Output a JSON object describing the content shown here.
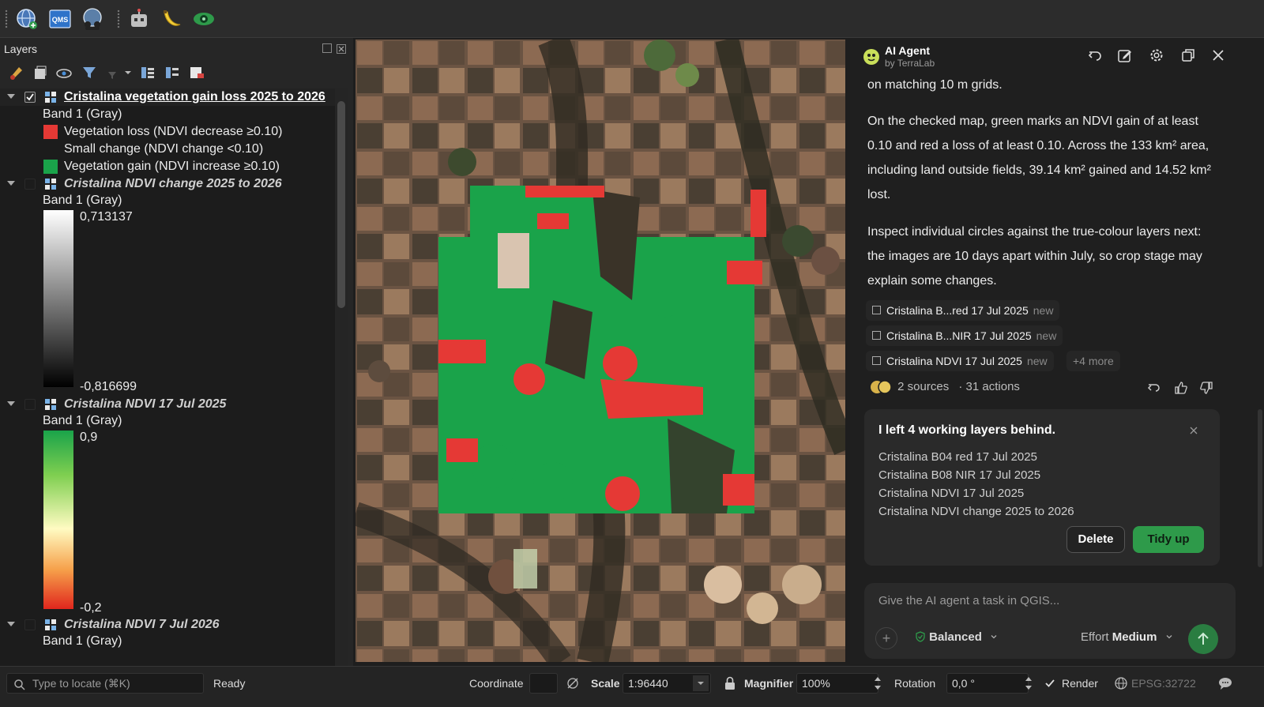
{
  "toolbar": {
    "icons": [
      "globe-add-icon",
      "qms-icon",
      "globe-people-icon",
      "robot-icon",
      "banana-icon",
      "eye-icon"
    ],
    "qms_label": "QMS"
  },
  "layers_panel": {
    "title": "Layers",
    "tree": [
      {
        "name": "Cristalina vegetation gain loss 2025 to 2026",
        "checked": true,
        "active": true
      },
      {
        "band": "Band 1 (Gray)"
      },
      {
        "legend": [
          {
            "label": "Vegetation loss (NDVI decrease ≥0.10)",
            "color": "#e53935"
          },
          {
            "label": "Small change (NDVI change <0.10)",
            "color": "transparent"
          },
          {
            "label": "Vegetation gain (NDVI increase ≥0.10)",
            "color": "#1aa34a"
          }
        ]
      },
      {
        "name": "Cristalina NDVI change 2025 to 2026",
        "checked": false,
        "band": "Band 1 (Gray)",
        "max": "0,713137",
        "min": "-0,816699"
      },
      {
        "name": "Cristalina NDVI 17 Jul 2025",
        "checked": false,
        "band": "Band 1 (Gray)",
        "max": "0,9",
        "min": "-0,2"
      },
      {
        "name": "Cristalina NDVI 7 Jul 2026",
        "checked": false,
        "band": "Band 1 (Gray)"
      }
    ]
  },
  "ai_panel": {
    "title": "AI Agent",
    "subtitle": "by TerraLab",
    "messages": [
      "on matching 10 m grids.",
      "On the checked map, green marks an NDVI gain of at least 0.10 and red a loss of at least 0.10. Across the 133 km² area, including land outside fields, 39.14 km² gained and 14.52 km² lost.",
      "Inspect individual circles against the true-colour layers next: the images are 10 days apart within July, so crop stage may explain some changes."
    ],
    "chips": [
      {
        "label": "Cristalina B...red 17 Jul 2025",
        "tag": "new"
      },
      {
        "label": "Cristalina B...NIR 17 Jul 2025",
        "tag": "new"
      },
      {
        "label": "Cristalina NDVI 17 Jul 2025",
        "tag": "new"
      }
    ],
    "more": "+4 more",
    "sources": "2 sources",
    "actions": "· 31 actions",
    "card": {
      "title": "I left 4 working layers behind.",
      "items": [
        "Cristalina B04 red 17 Jul 2025",
        "Cristalina B08 NIR 17 Jul 2025",
        "Cristalina NDVI 17 Jul 2025",
        "Cristalina NDVI change 2025 to 2026"
      ],
      "delete_label": "Delete",
      "tidy_label": "Tidy up"
    },
    "composer": {
      "placeholder": "Give the AI agent a task in QGIS...",
      "mode": "Balanced",
      "effort_prefix": "Effort",
      "effort": "Medium"
    },
    "colors": {
      "accent": "#2e9a4a",
      "loss": "#e53935",
      "gain": "#1aa34a"
    }
  },
  "statusbar": {
    "locate_placeholder": "Type to locate (⌘K)",
    "ready": "Ready",
    "coordinate_label": "Coordinate",
    "coordinate_value": "",
    "scale_label": "Scale",
    "scale_value": "1:96440",
    "magnifier_label": "Magnifier",
    "magnifier_value": "100%",
    "rotation_label": "Rotation",
    "rotation_value": "0,0 °",
    "render_label": "Render",
    "render_checked": true,
    "crs": "EPSG:32722"
  }
}
